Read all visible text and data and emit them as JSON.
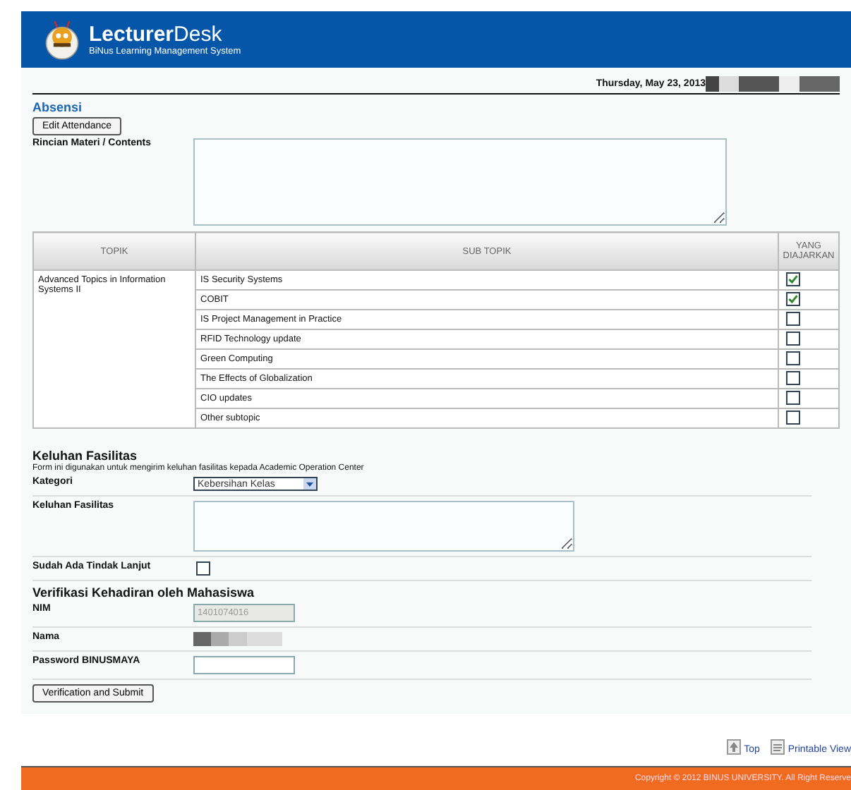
{
  "header": {
    "brand_bold": "Lecturer",
    "brand_light": "Desk",
    "subtitle": "BiNus Learning Management System"
  },
  "date": "Thursday, May 23, 2013",
  "section_title": "Absensi",
  "edit_button": "Edit Attendance",
  "contents_label": "Rincian Materi / Contents",
  "table": {
    "columns": [
      "TOPIK",
      "SUB TOPIK",
      "YANG DIAJARKAN"
    ],
    "topic": "Advanced Topics in Information Systems II",
    "rows": [
      {
        "subtopic": "IS Security Systems",
        "checked": true
      },
      {
        "subtopic": "COBIT",
        "checked": true
      },
      {
        "subtopic": "IS Project Management in Practice",
        "checked": false
      },
      {
        "subtopic": "RFID Technology update",
        "checked": false
      },
      {
        "subtopic": "Green Computing",
        "checked": false
      },
      {
        "subtopic": "The Effects of Globalization",
        "checked": false
      },
      {
        "subtopic": "CIO updates",
        "checked": false
      },
      {
        "subtopic": "Other subtopic",
        "checked": false
      }
    ]
  },
  "complaint": {
    "title": "Keluhan Fasilitas",
    "description": "Form ini digunakan untuk mengirim keluhan fasilitas kepada Academic Operation Center",
    "category_label": "Kategori",
    "category_value": "Kebersihan Kelas",
    "complaint_label": "Keluhan Fasilitas",
    "followup_label": "Sudah Ada Tindak Lanjut",
    "followup_checked": false
  },
  "verification": {
    "title": "Verifikasi Kehadiran oleh Mahasiswa",
    "nim_label": "NIM",
    "nim_value": "1401074016",
    "name_label": "Nama",
    "password_label": "Password BINUSMAYA",
    "submit": "Verification and Submit"
  },
  "links": [
    "Top",
    "Printable View"
  ],
  "footer": "Copyright © 2012 BINUS UNIVERSITY. All Right Reserve"
}
